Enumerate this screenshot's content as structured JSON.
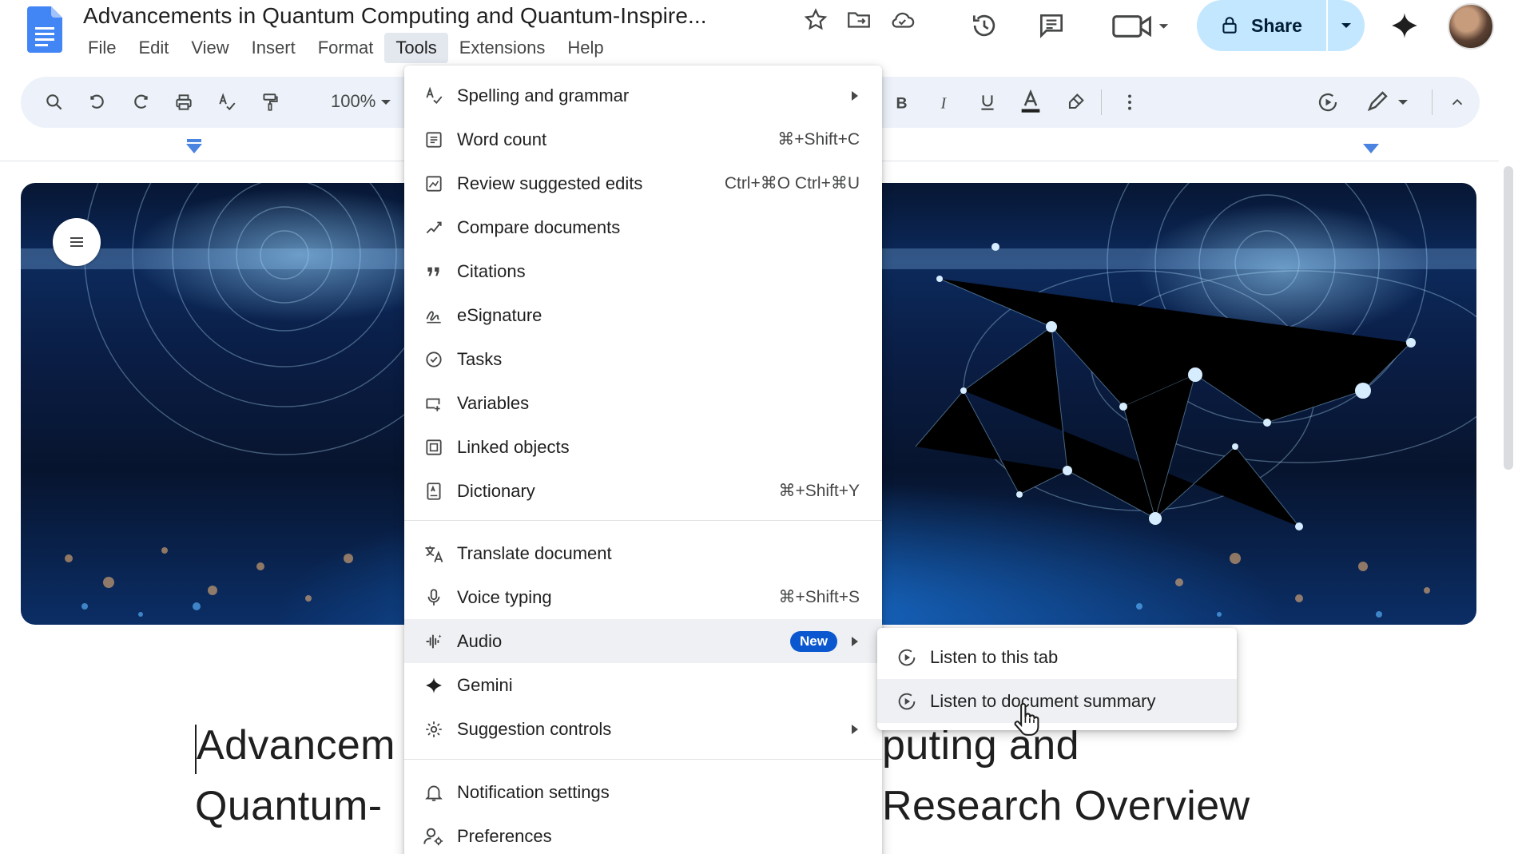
{
  "app": {
    "doc_title": "Advancements in Quantum Computing and Quantum-Inspire...",
    "menus": [
      "File",
      "Edit",
      "View",
      "Insert",
      "Format",
      "Tools",
      "Extensions",
      "Help"
    ],
    "active_menu": "Tools",
    "share_label": "Share"
  },
  "toolbar": {
    "zoom": "100%"
  },
  "document": {
    "heading_line1_left": "Advancem",
    "heading_line1_right": "puting and",
    "heading_line2_left": "Quantum-",
    "heading_line2_right": "Research Overview"
  },
  "tools_menu": {
    "items": [
      {
        "label": "Spelling and grammar",
        "icon": "spellcheck-icon",
        "submenu": true
      },
      {
        "label": "Word count",
        "icon": "word-count-icon",
        "shortcut": "⌘+Shift+C"
      },
      {
        "label": "Review suggested edits",
        "icon": "review-edits-icon",
        "shortcut": "Ctrl+⌘O Ctrl+⌘U"
      },
      {
        "label": "Compare documents",
        "icon": "compare-icon"
      },
      {
        "label": "Citations",
        "icon": "quote-icon"
      },
      {
        "label": "eSignature",
        "icon": "signature-icon"
      },
      {
        "label": "Tasks",
        "icon": "tasks-icon"
      },
      {
        "label": "Variables",
        "icon": "variables-icon"
      },
      {
        "label": "Linked objects",
        "icon": "linked-objects-icon"
      },
      {
        "label": "Dictionary",
        "icon": "dictionary-icon",
        "shortcut": "⌘+Shift+Y"
      },
      {
        "label": "Translate document",
        "icon": "translate-icon"
      },
      {
        "label": "Voice typing",
        "icon": "microphone-icon",
        "shortcut": "⌘+Shift+S"
      },
      {
        "label": "Audio",
        "icon": "audio-icon",
        "badge": "New",
        "submenu": true
      },
      {
        "label": "Gemini",
        "icon": "gemini-icon"
      },
      {
        "label": "Suggestion controls",
        "icon": "suggestion-controls-icon",
        "submenu": true
      },
      {
        "label": "Notification settings",
        "icon": "bell-icon"
      },
      {
        "label": "Preferences",
        "icon": "preferences-icon"
      }
    ]
  },
  "audio_submenu": {
    "items": [
      {
        "label": "Listen to this tab",
        "icon": "play-circle-icon"
      },
      {
        "label": "Listen to document summary",
        "icon": "play-circle-icon"
      }
    ]
  },
  "colors": {
    "accent": "#0b57d0",
    "share_bg": "#c2e7ff",
    "toolbar_bg": "#edf2fa",
    "menu_active_bg": "#e3e8ef"
  }
}
